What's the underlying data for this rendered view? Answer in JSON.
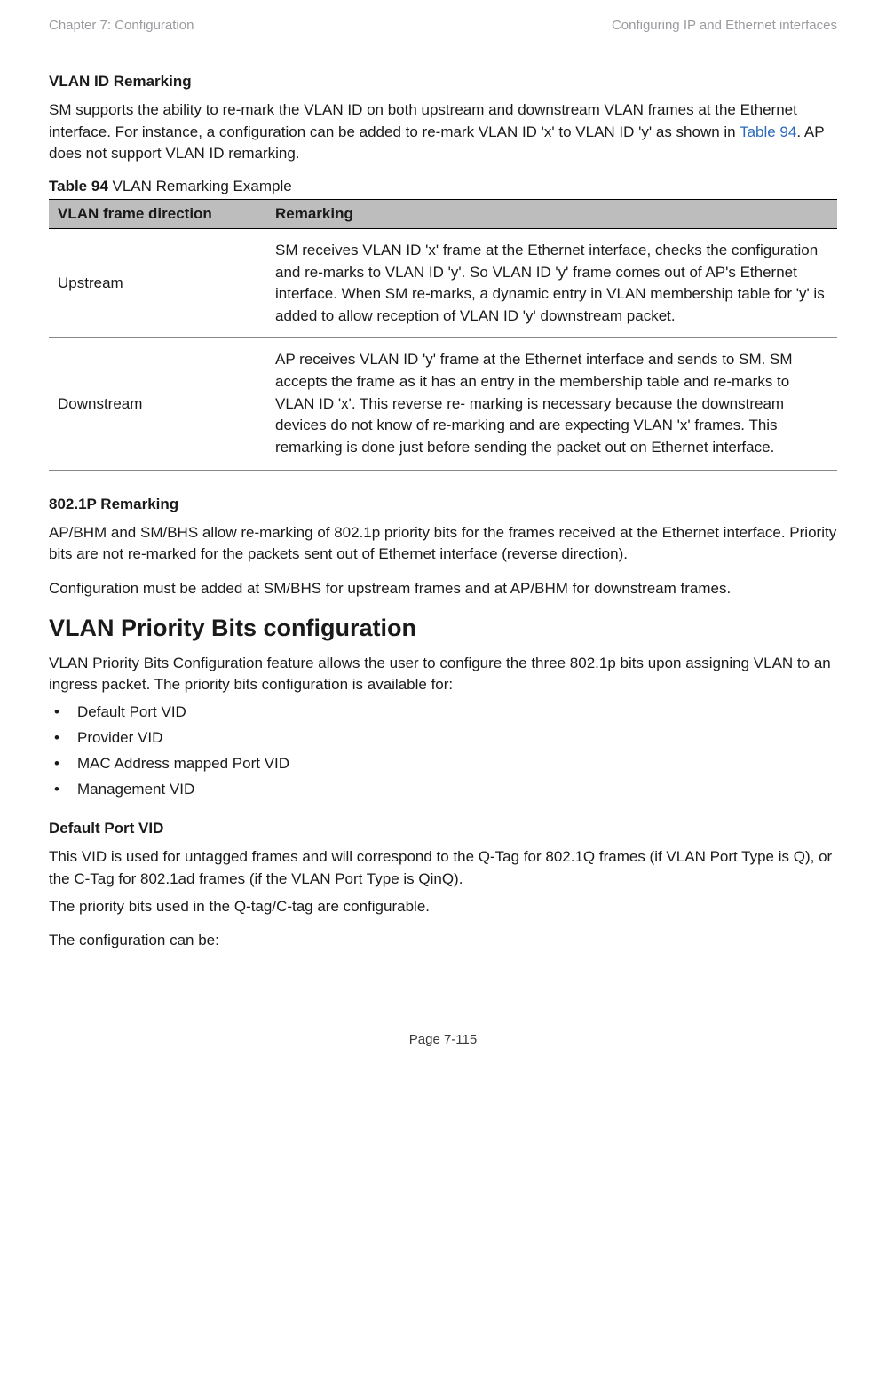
{
  "header": {
    "left": "Chapter 7:  Configuration",
    "right": "Configuring IP and Ethernet interfaces"
  },
  "section1": {
    "heading": "VLAN ID Remarking",
    "para_a": "SM supports the ability to re-mark the VLAN ID on both upstream and downstream VLAN frames at the Ethernet interface. For instance, a configuration can be added to re-mark VLAN ID 'x' to VLAN ID 'y' as shown in ",
    "para_link": "Table 94",
    "para_b": ". AP does not support VLAN ID remarking."
  },
  "table": {
    "caption_bold": "Table 94",
    "caption_rest": " VLAN Remarking Example",
    "headers": [
      "VLAN frame direction",
      "Remarking"
    ],
    "rows": [
      {
        "direction": "Upstream",
        "remarking": "SM receives VLAN ID 'x' frame at the Ethernet interface, checks the configuration and re-marks to VLAN ID 'y'. So VLAN ID 'y' frame comes out of AP's Ethernet interface. When SM re-marks, a dynamic entry in VLAN membership table for 'y' is added to allow reception of VLAN ID 'y' downstream packet."
      },
      {
        "direction": "Downstream",
        "remarking": "AP receives VLAN ID 'y' frame at the Ethernet interface and sends to SM. SM accepts the frame as it has an entry in the membership table and re-marks to VLAN ID 'x'. This reverse re- marking is necessary because the downstream devices do not know of re-marking and are expecting VLAN 'x' frames. This remarking is done just before sending the packet out on Ethernet interface."
      }
    ]
  },
  "section2": {
    "heading": "802.1P Remarking",
    "para1": "AP/BHM and SM/BHS allow re-marking of 802.1p priority bits for the frames received at the Ethernet interface. Priority bits are not re-marked for the packets sent out of Ethernet interface (reverse direction).",
    "para2": "Configuration must be added at SM/BHS for upstream frames and at AP/BHM for downstream frames."
  },
  "section3": {
    "heading": "VLAN Priority Bits configuration",
    "para": "VLAN Priority Bits Configuration feature allows the user to configure the three 802.1p bits upon assigning VLAN to an ingress packet. The priority bits configuration is available for:",
    "items": [
      "Default Port VID",
      "Provider VID",
      "MAC Address mapped Port VID",
      "Management VID"
    ]
  },
  "section4": {
    "heading": "Default Port VID",
    "para1": "This VID is used for untagged frames and will correspond to the Q-Tag for 802.1Q frames (if VLAN  Port Type is Q), or the C-Tag for 802.1ad frames (if the VLAN Port Type is QinQ).",
    "para2": "The priority bits used in the Q-tag/C-tag are configurable.",
    "para3": "The configuration can be:"
  },
  "footer": "Page 7-115"
}
